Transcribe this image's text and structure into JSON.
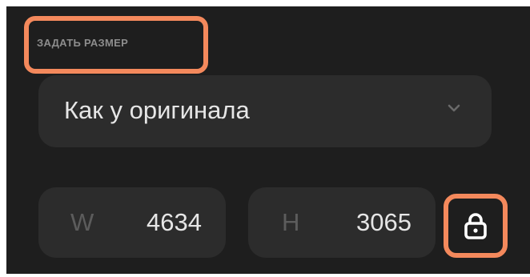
{
  "section": {
    "title": "ЗАДАТЬ РАЗМЕР"
  },
  "size_select": {
    "value": "Как у оригинала",
    "icon": "chevron-down-icon"
  },
  "width": {
    "label": "W",
    "value": "4634"
  },
  "height": {
    "label": "H",
    "value": "3065"
  },
  "lock": {
    "icon": "lock-icon"
  },
  "colors": {
    "panel_bg": "#1e1e1e",
    "field_bg": "#2c2c2c",
    "highlight": "#f4895c",
    "text": "#e6e6e6",
    "muted": "#5c5c5c"
  }
}
